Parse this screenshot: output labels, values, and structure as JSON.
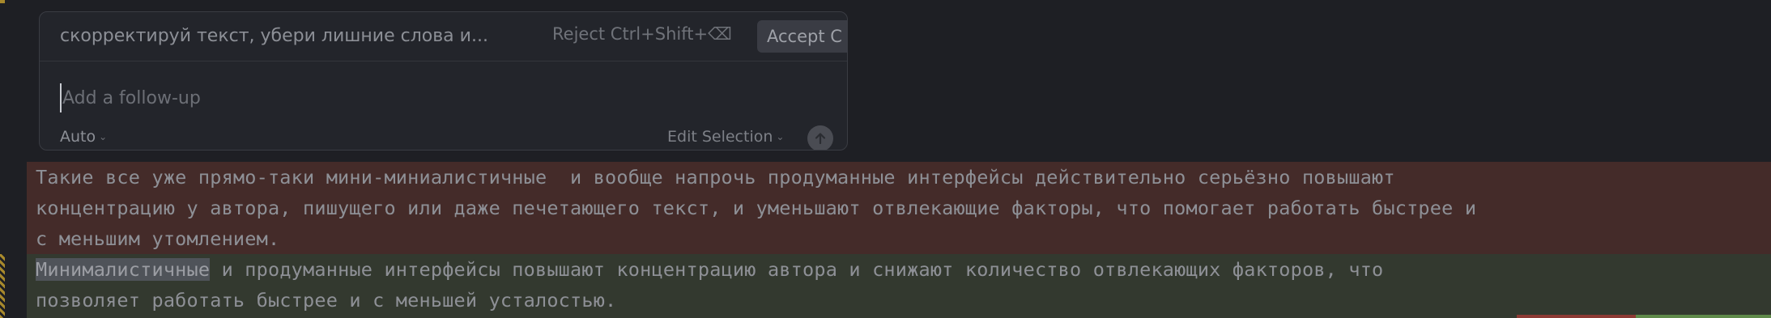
{
  "prompt": {
    "text": "скорректируй текст, убери лишние слова и...",
    "reject_label": "Reject Ctrl+Shift+⌫",
    "accept_label": "Accept C",
    "followup_placeholder": "Add a follow-up",
    "mode_label": "Auto",
    "edit_selection_label": "Edit Selection"
  },
  "diff": {
    "removed_lines": [
      "Такие все уже прямо-таки мини-миниалистичные  и вообще напрочь продуманные интерфейсы действительно серьёзно повышают",
      "концентрацию у автора, пишущего или даже печетающего текст, и уменьшают отвлекающие факторы, что помогает работать быстрее и",
      "с меньшим утомлением."
    ],
    "added_selected_word": "Минималистичные",
    "added_line1_rest": " и продуманные интерфейсы повышают концентрацию автора и снижают количество отвлекающих факторов, что",
    "added_line2": "позволяет работать быстрее и с меньшей усталостью."
  },
  "colors": {
    "removed_bg": "#442b29",
    "added_bg": "#33392f",
    "accent_warning": "#a8892c"
  },
  "icons": {
    "send": "arrow-up-icon",
    "dropdown": "chevron-down-icon"
  }
}
